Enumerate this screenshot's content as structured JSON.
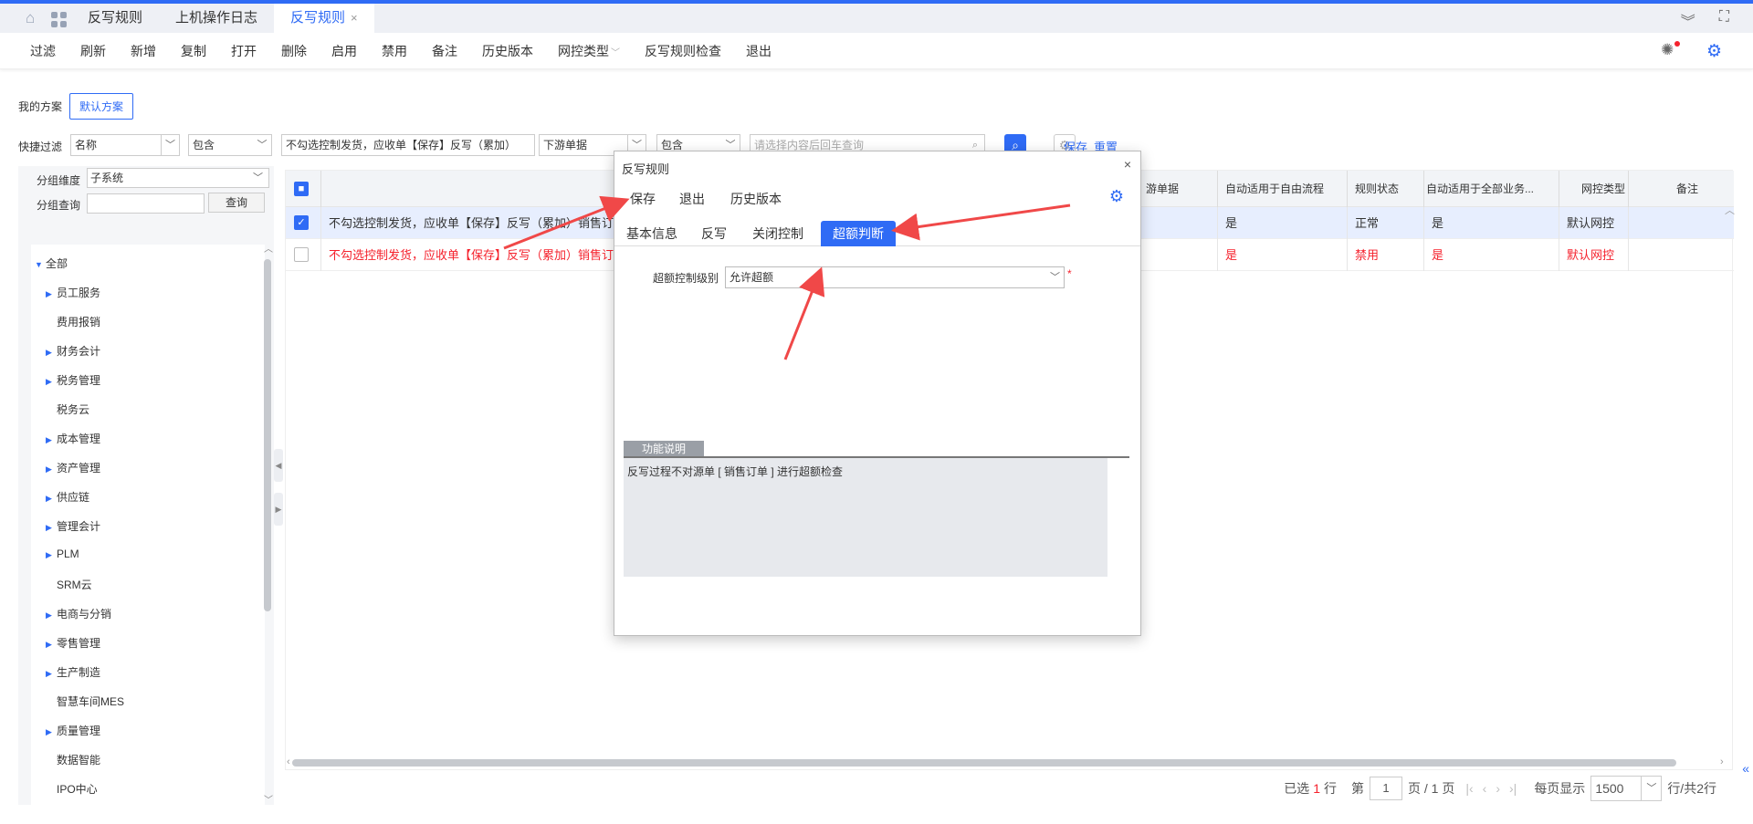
{
  "tabs": [
    {
      "label": "反写规则",
      "active": false
    },
    {
      "label": "上机操作日志",
      "active": false
    },
    {
      "label": "反写规则",
      "active": true
    }
  ],
  "toolbar": {
    "items": [
      "过滤",
      "刷新",
      "新增",
      "复制",
      "打开",
      "删除",
      "启用",
      "禁用",
      "备注",
      "历史版本",
      "网控类型",
      "反写规则检查",
      "退出"
    ]
  },
  "scheme": {
    "label": "我的方案",
    "default_button": "默认方案"
  },
  "quick_filter": {
    "label": "快捷过滤",
    "field1": "名称",
    "op1": "包含",
    "value1": "不勾选控制发货，应收单【保存】反写（累加）",
    "field2": "下游单据",
    "op2": "包含",
    "placeholder": "请选择内容后回车查询",
    "save": "保存",
    "reset": "重置"
  },
  "left": {
    "group_dim_label": "分组维度",
    "group_dim_value": "子系统",
    "group_query_label": "分组查询",
    "query_button": "查询",
    "tree": [
      {
        "label": "全部",
        "expand": "open",
        "level": 0
      },
      {
        "label": "员工服务",
        "expand": "closed",
        "level": 1
      },
      {
        "label": "费用报销",
        "expand": "none",
        "level": 1
      },
      {
        "label": "财务会计",
        "expand": "closed",
        "level": 1
      },
      {
        "label": "税务管理",
        "expand": "closed",
        "level": 1
      },
      {
        "label": "税务云",
        "expand": "none",
        "level": 1
      },
      {
        "label": "成本管理",
        "expand": "closed",
        "level": 1
      },
      {
        "label": "资产管理",
        "expand": "closed",
        "level": 1
      },
      {
        "label": "供应链",
        "expand": "closed",
        "level": 1
      },
      {
        "label": "管理会计",
        "expand": "closed",
        "level": 1
      },
      {
        "label": "PLM",
        "expand": "closed",
        "level": 1
      },
      {
        "label": "SRM云",
        "expand": "none",
        "level": 1
      },
      {
        "label": "电商与分销",
        "expand": "closed",
        "level": 1
      },
      {
        "label": "零售管理",
        "expand": "closed",
        "level": 1
      },
      {
        "label": "生产制造",
        "expand": "closed",
        "level": 1
      },
      {
        "label": "智慧车间MES",
        "expand": "none",
        "level": 1
      },
      {
        "label": "质量管理",
        "expand": "closed",
        "level": 1
      },
      {
        "label": "数据智能",
        "expand": "none",
        "level": 1
      },
      {
        "label": "IPO中心",
        "expand": "none",
        "level": 1
      }
    ]
  },
  "grid": {
    "headers": {
      "downstream": "游单据",
      "auto_free": "自动适用于自由流程",
      "status": "规则状态",
      "auto_all": "自动适用于全部业务...",
      "net_type": "网控类型",
      "remark": "备注"
    },
    "rows": [
      {
        "checked": true,
        "name": "不勾选控制发货，应收单【保存】反写（累加）销售订单",
        "auto_free": "是",
        "status": "正常",
        "auto_all": "是",
        "net_type": "默认网控",
        "red": false
      },
      {
        "checked": false,
        "name": "不勾选控制发货，应收单【保存】反写（累加）销售订单",
        "auto_free": "是",
        "status": "禁用",
        "auto_all": "是",
        "net_type": "默认网控",
        "red": true
      }
    ]
  },
  "pager": {
    "selected_prefix": "已选",
    "selected_count": "1",
    "selected_suffix": "行",
    "page_prefix": "第",
    "page": "1",
    "page_suffix": "页 / 1 页",
    "per_page_label": "每页显示",
    "per_page": "1500",
    "total": "行/共2行"
  },
  "dialog": {
    "title": "反写规则",
    "toolbar": [
      "保存",
      "退出",
      "历史版本"
    ],
    "tabs": [
      "基本信息",
      "反写",
      "关闭控制",
      "超额判断"
    ],
    "active_tab": "超额判断",
    "field_label": "超额控制级别",
    "field_value": "允许超额",
    "func_tab": "功能说明",
    "func_text": "反写过程不对源单 [ 销售订单 ] 进行超额检查"
  },
  "colors": {
    "accent": "#2f6bf5",
    "danger": "#f5222d",
    "arrow": "#f04848"
  }
}
